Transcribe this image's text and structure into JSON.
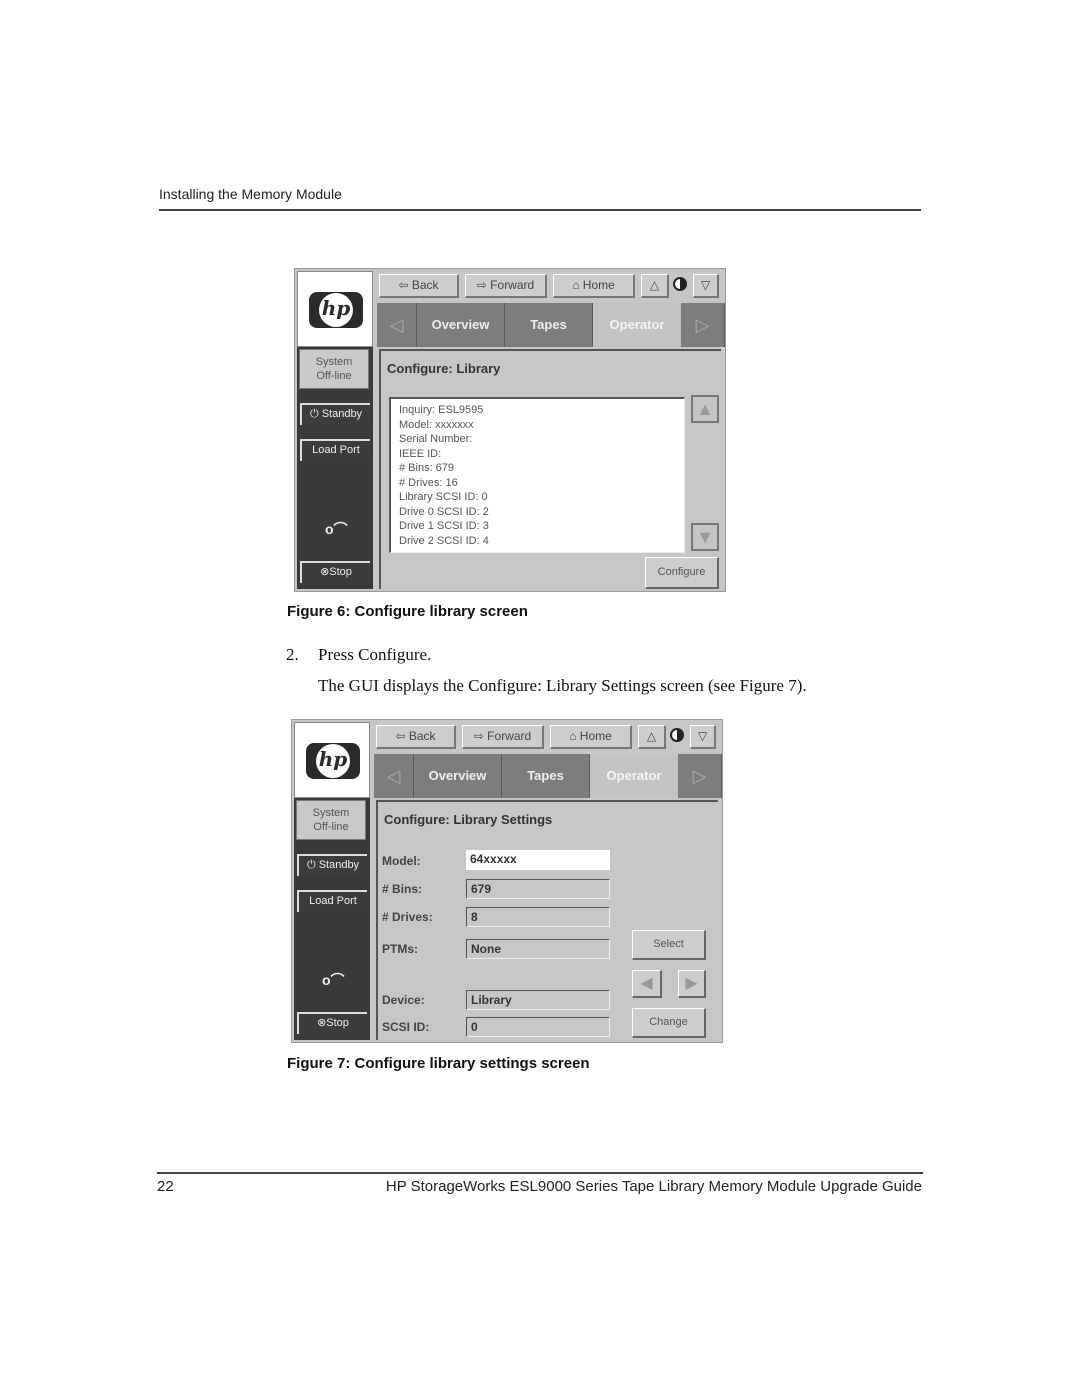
{
  "page": {
    "running_header": "Installing the Memory Module",
    "page_number": "22",
    "footer_title": "HP StorageWorks ESL9000 Series Tape Library Memory Module Upgrade Guide"
  },
  "gui_common": {
    "logo_text": "hp",
    "system_status_line1": "System",
    "system_status_line2": "Off-line",
    "standby_label": "⏻ Standby",
    "load_port_label": "Load Port",
    "lock_icon": "o⌒",
    "stop_label": "⊗Stop",
    "nav": {
      "back_label": "⇦ Back",
      "forward_label": "⇨ Forward",
      "home_label": "⌂ Home",
      "brightness_up_icon": "△",
      "brightness_down_icon": "▽"
    },
    "tabs": {
      "prev_icon": "◁",
      "next_icon": "▷",
      "items": [
        "Overview",
        "Tapes",
        "Operator"
      ],
      "active": "Operator"
    }
  },
  "figure6": {
    "caption": "Figure 6:  Configure library screen",
    "title": "Configure: Library",
    "info_lines": [
      "Inquiry:   ESL9595",
      "Model:    xxxxxxx",
      "Serial Number:",
      "IEEE ID:",
      "# Bins:    679",
      "# Drives: 16",
      "Library SCSI ID: 0",
      "Drive 0 SCSI ID:  2",
      "Drive 1 SCSI ID:  3",
      "Drive 2 SCSI ID:  4"
    ],
    "scroll_up_icon": "▲",
    "scroll_down_icon": "▼",
    "configure_label": "Configure"
  },
  "step": {
    "number": "2.",
    "text": "Press Configure.",
    "description": "The GUI displays the Configure: Library Settings screen (see Figure 7)."
  },
  "figure7": {
    "caption": "Figure 7:  Configure library settings screen",
    "title": "Configure: Library Settings",
    "fields": [
      {
        "label": "Model:",
        "value": "64xxxxx"
      },
      {
        "label": "# Bins:",
        "value": "679"
      },
      {
        "label": "# Drives:",
        "value": "8"
      },
      {
        "label": "PTMs:",
        "value": "None"
      },
      {
        "label": "Device:",
        "value": "Library"
      },
      {
        "label": "SCSI ID:",
        "value": "0"
      }
    ],
    "select_label": "Select",
    "prev_icon": "◀",
    "next_icon": "▶",
    "change_label": "Change"
  }
}
